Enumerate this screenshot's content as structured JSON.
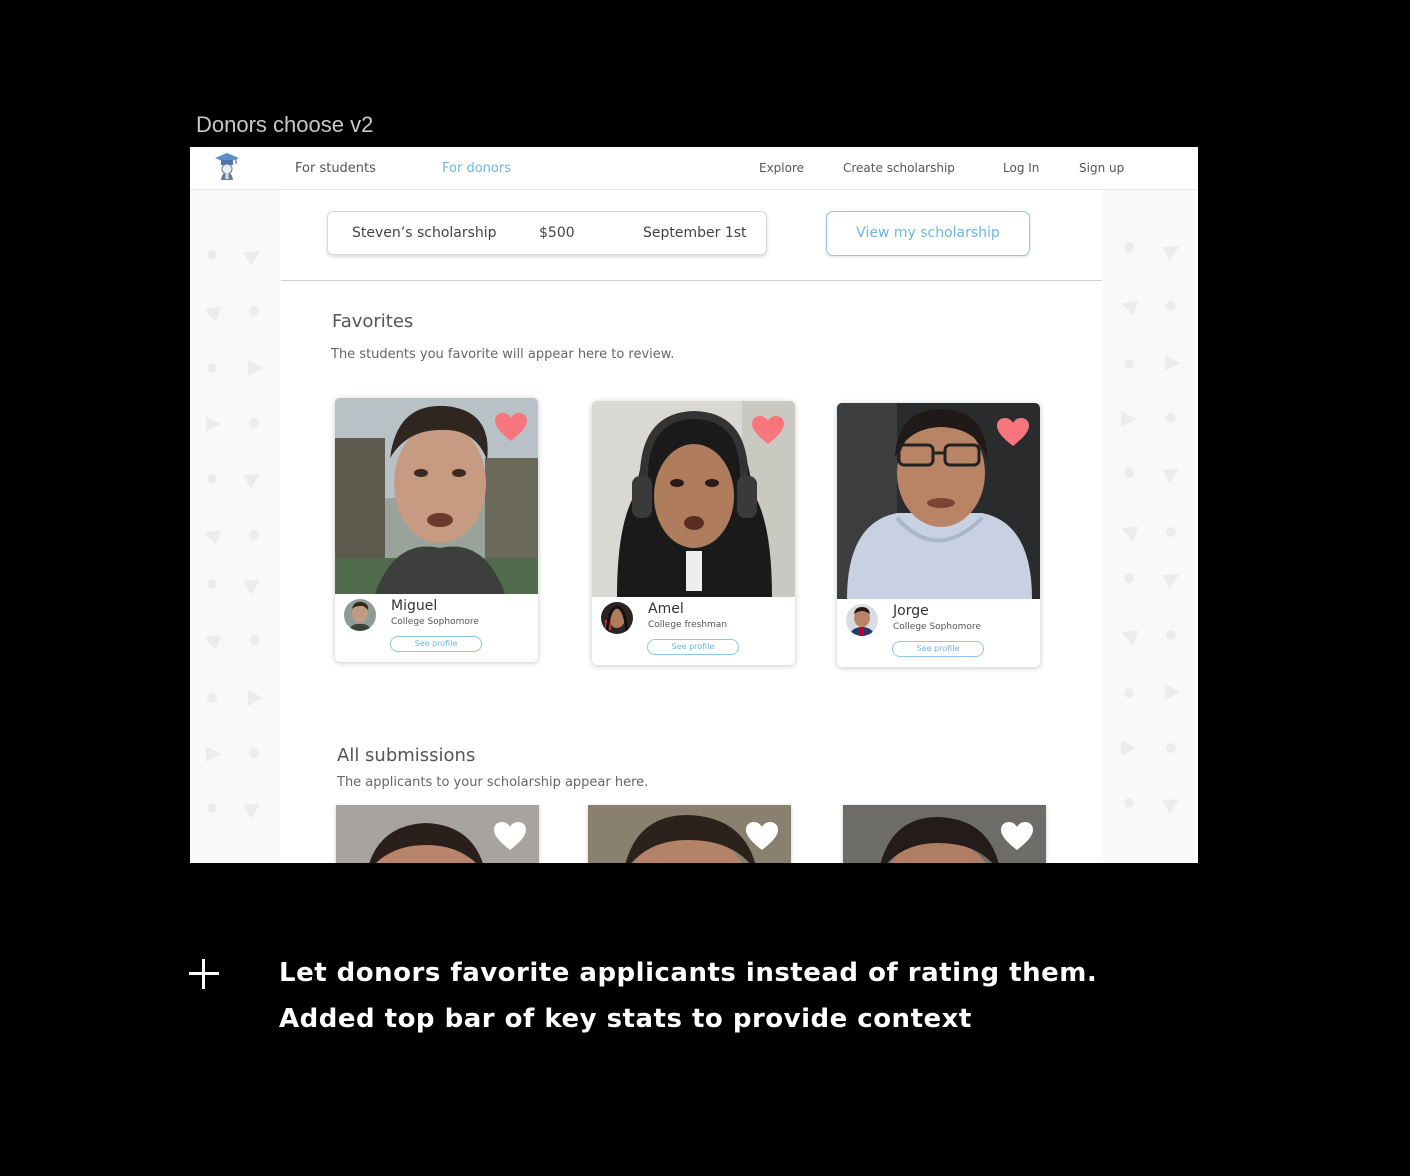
{
  "frame_title": "Donors choose v2",
  "nav": {
    "for_students": "For students",
    "for_donors": "For donors",
    "explore": "Explore",
    "create_scholarship": "Create scholarship",
    "log_in": "Log In",
    "sign_up": "Sign up",
    "active_color": "#6db6e2"
  },
  "stats": {
    "scholarship_name": "Steven’s scholarship",
    "amount": "$500",
    "deadline": "September 1st",
    "view_button": "View my scholarship"
  },
  "favorites": {
    "title": "Favorites",
    "subtitle": "The students you favorite will appear here to review.",
    "cards": [
      {
        "name": "Miguel",
        "level": "College Sophomore",
        "button": "See profile",
        "favorited": true
      },
      {
        "name": "Amel",
        "level": "College freshman",
        "button": "See profile",
        "favorited": true
      },
      {
        "name": "Jorge",
        "level": "College Sophomore",
        "button": "See profile",
        "favorited": true
      }
    ]
  },
  "submissions": {
    "title": "All submissions",
    "subtitle": "The applicants to your scholarship appear here."
  },
  "notes": {
    "line1": "Let donors favorite applicants instead of rating them.",
    "line2": "Added top bar of key stats to provide context"
  },
  "colors": {
    "heart_favorited": "#f7767e",
    "heart_default": "#ffffff",
    "accent": "#6db6e2"
  }
}
